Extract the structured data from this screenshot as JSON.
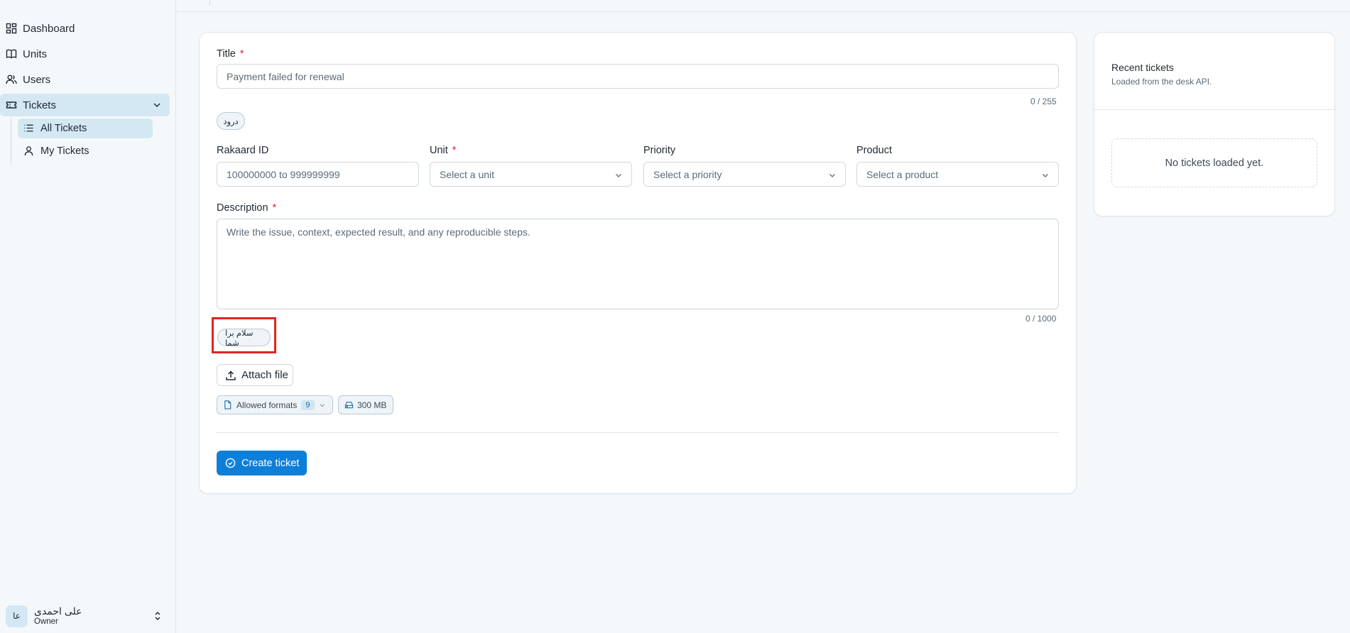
{
  "sidebar": {
    "items": [
      {
        "label": "Dashboard",
        "icon": "dashboard-icon"
      },
      {
        "label": "Units",
        "icon": "book-icon"
      },
      {
        "label": "Users",
        "icon": "users-icon"
      },
      {
        "label": "Tickets",
        "icon": "ticket-icon"
      }
    ],
    "subitems": [
      {
        "label": "All Tickets",
        "icon": "list-icon"
      },
      {
        "label": "My Tickets",
        "icon": "user-icon"
      }
    ],
    "user": {
      "initials": "عا",
      "name": "علی احمدی",
      "role": "Owner"
    }
  },
  "form": {
    "title_label": "Title",
    "title_value": "Payment failed for renewal",
    "title_counter": "0 / 255",
    "title_chip": "درود",
    "rakaard_label": "Rakaard ID",
    "rakaard_placeholder": "100000000 to 999999999",
    "unit_label": "Unit",
    "unit_placeholder": "Select a unit",
    "priority_label": "Priority",
    "priority_placeholder": "Select a priority",
    "product_label": "Product",
    "product_placeholder": "Select a product",
    "description_label": "Description",
    "description_placeholder": "Write the issue, context, expected result, and any reproducible steps.",
    "description_counter": "0 / 1000",
    "description_chip": "سلام برا شما",
    "attach_label": "Attach file",
    "formats_label": "Allowed formats",
    "formats_count": "9",
    "size_label": "300 MB",
    "create_label": "Create ticket",
    "required_mark": "*"
  },
  "recent": {
    "title": "Recent tickets",
    "subtitle": "Loaded from the desk API.",
    "empty": "No tickets loaded yet."
  },
  "colors": {
    "accent": "#0e7fd8",
    "active_bg": "#d4e8f3",
    "required": "#e02424"
  }
}
